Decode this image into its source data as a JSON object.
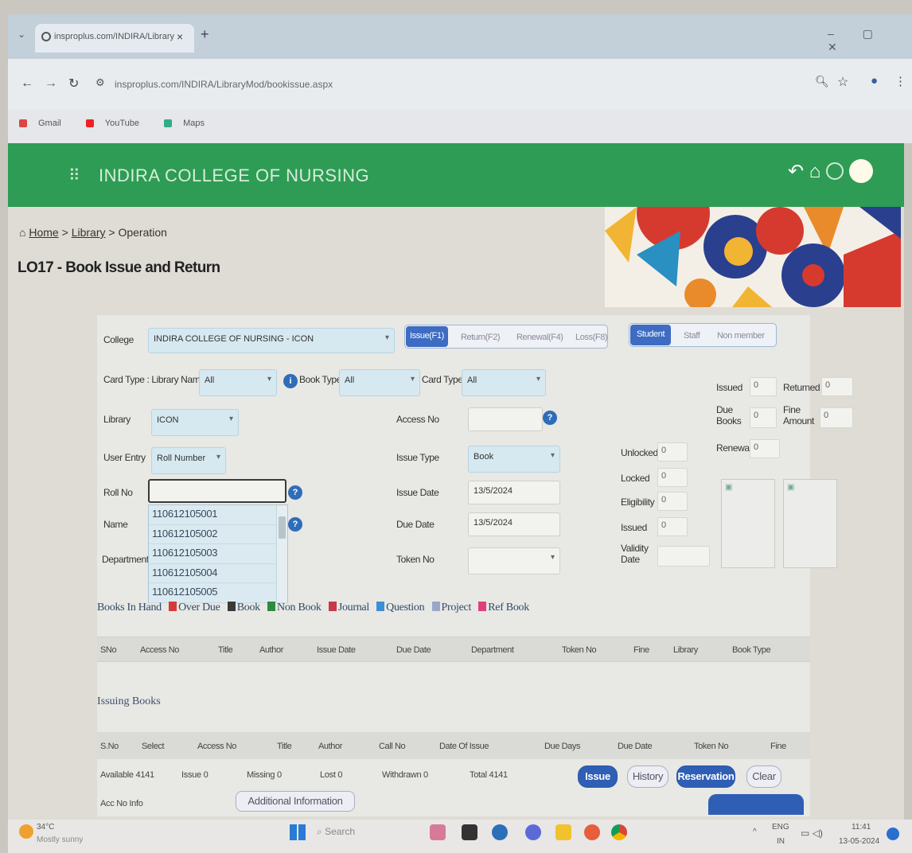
{
  "browser": {
    "tab_title": "insproplus.com/INDIRA/Library",
    "tab_close": "×",
    "new_tab": "+",
    "url": "insproplus.com/INDIRA/LibraryMod/bookissue.aspx",
    "bookmarks": [
      "Gmail",
      "YouTube",
      "Maps"
    ]
  },
  "app": {
    "title": "INDIRA COLLEGE OF NURSING"
  },
  "breadcrumb": {
    "home": "Home",
    "sep": ">",
    "library": "Library",
    "current": "Operation"
  },
  "page_title": "LO17 - Book Issue and Return",
  "form": {
    "college_label": "College",
    "college_value": "INDIRA COLLEGE OF NURSING - ICON",
    "modes": [
      "Issue(F1)",
      "Return(F2)",
      "Renewal(F4)",
      "Loss(F8)"
    ],
    "member_types": [
      "Student",
      "Staff",
      "Non member"
    ],
    "card_type_lib_label": "Card Type : Library Name",
    "card_type_lib_value": "All",
    "book_type_label": "Book Type",
    "book_type_value": "All",
    "card_type_label": "Card Type",
    "card_type_value": "All",
    "library_label": "Library",
    "library_value": "ICON",
    "user_entry_label": "User Entry",
    "user_entry_value": "Roll Number",
    "roll_no_label": "Roll No",
    "roll_no_value": "",
    "name_label": "Name",
    "department_label": "Department",
    "access_no_label": "Access No",
    "issue_type_label": "Issue Type",
    "issue_type_value": "Book",
    "issue_date_label": "Issue Date",
    "issue_date_value": "13/5/2024",
    "due_date_label": "Due Date",
    "due_date_value": "13/5/2024",
    "token_no_label": "Token No",
    "unlocked_label": "Unlocked",
    "unlocked_value": "0",
    "locked_label": "Locked",
    "locked_value": "0",
    "eligibility_label": "Eligibility",
    "eligibility_value": "0",
    "issued_mid_label": "Issued",
    "issued_mid_value": "0",
    "validity_label": "Validity Date",
    "issued_label": "Issued",
    "issued_value": "0",
    "returned_label": "Returned",
    "returned_value": "0",
    "due_books_label": "Due Books",
    "due_books_value": "0",
    "fine_amount_label": "Fine Amount",
    "fine_amount_value": "0",
    "renewal_label": "Renewal",
    "renewal_value": "0"
  },
  "roll_dropdown": [
    "110612105001",
    "110612105002",
    "110612105003",
    "110612105004",
    "110612105005"
  ],
  "legend": {
    "title": "Books In Hand",
    "items": [
      {
        "label": "Over Due",
        "color": "#d63b3b"
      },
      {
        "label": "Book",
        "color": "#3a3a3a"
      },
      {
        "label": "Non Book",
        "color": "#2d8a3e"
      },
      {
        "label": "Journal",
        "color": "#c43a4a"
      },
      {
        "label": "Question",
        "color": "#3c8fd6"
      },
      {
        "label": "Project",
        "color": "#9aa7c9"
      },
      {
        "label": "Ref Book",
        "color": "#e0407a"
      }
    ]
  },
  "books_in_hand_columns": [
    "SNo",
    "Access No",
    "Title",
    "Author",
    "Issue Date",
    "Due Date",
    "Department",
    "Token No",
    "Fine",
    "Library",
    "Book Type"
  ],
  "issuing_books_title": "Issuing Books",
  "issuing_columns": [
    "S.No",
    "Select",
    "Access No",
    "Title",
    "Author",
    "Call No",
    "Date Of Issue",
    "Due Days",
    "Due Date",
    "Token No",
    "Fine"
  ],
  "stats": {
    "available_label": "Available",
    "available_value": "4141",
    "issue_label": "Issue",
    "issue_value": "0",
    "missing_label": "Missing",
    "missing_value": "0",
    "lost_label": "Lost",
    "lost_value": "0",
    "withdrawn_label": "Withdrawn",
    "withdrawn_value": "0",
    "total_label": "Total",
    "total_value": "4141"
  },
  "buttons": {
    "issue": "Issue",
    "history": "History",
    "reservation": "Reservation",
    "clear": "Clear",
    "additional_info": "Additional Information",
    "acc_no_info": "Acc No Info"
  },
  "taskbar": {
    "weather_temp": "34°C",
    "weather_desc": "Mostly sunny",
    "search": "Search",
    "lang": "ENG",
    "region": "IN",
    "time": "11:41",
    "date": "13-05-2024"
  },
  "colors": {
    "header_green": "#2e9c55",
    "primary_blue": "#2f5fb5"
  }
}
